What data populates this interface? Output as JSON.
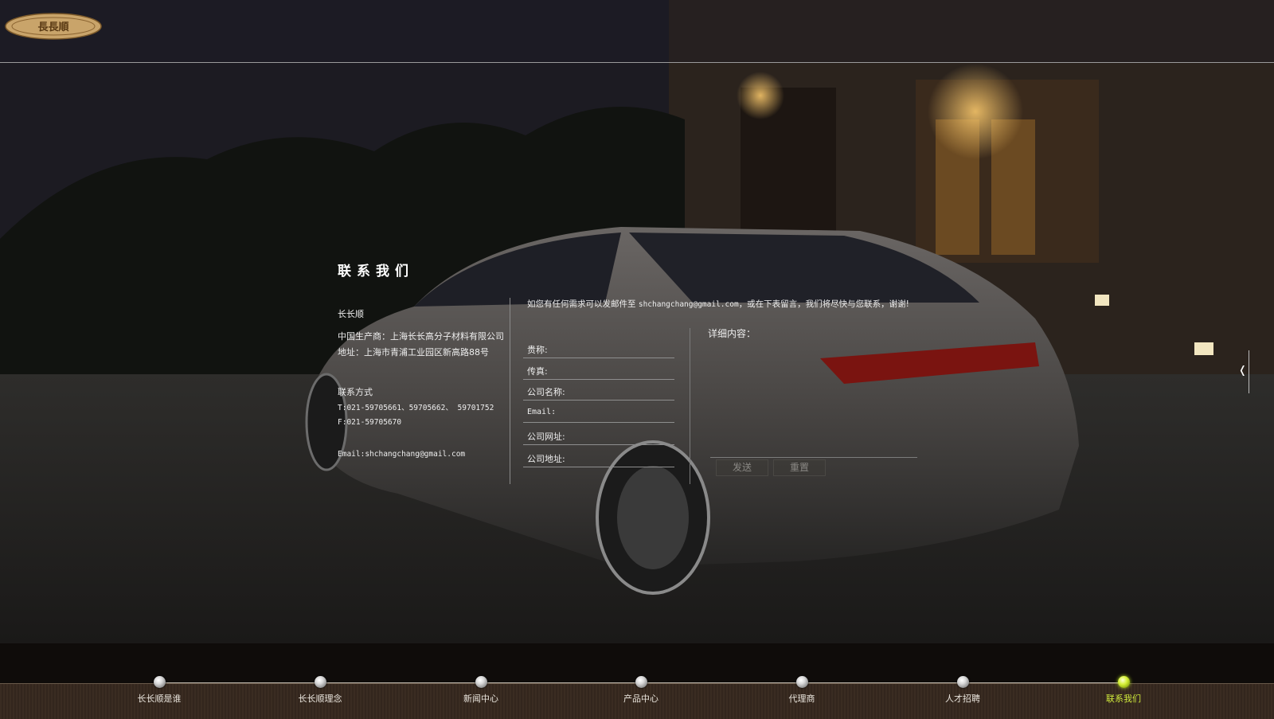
{
  "brand": {
    "logo_text": "長長順"
  },
  "contact": {
    "title": "联系我们",
    "company_short": "长长顺",
    "manufacturer": "中国生产商：上海长长高分子材料有限公司",
    "address": "地址：上海市青浦工业园区新高路88号",
    "method_label": "联系方式",
    "tel": "T:021-59705661、59705662、 59701752",
    "fax": "F:021-59705670",
    "email": "Email:shchangchang@gmail.com"
  },
  "form": {
    "intro_prefix": "如您有任何需求可以发邮件至",
    "intro_email": "shchangchang@gmail.com",
    "intro_suffix": "，或在下表留言，我们将尽快与您联系，谢谢!",
    "fields": [
      {
        "label": "贵称:"
      },
      {
        "label": "传真:"
      },
      {
        "label": "公司名称:"
      },
      {
        "label": "Email:"
      },
      {
        "label": "公司网址:"
      },
      {
        "label": "公司地址:"
      }
    ],
    "detail_label": "详细内容：",
    "send_label": "发送",
    "reset_label": "重置"
  },
  "side_tab": {
    "glyph": "❬"
  },
  "nav": {
    "items": [
      {
        "label": "长长顺是谁",
        "active": false
      },
      {
        "label": "长长顺理念",
        "active": false
      },
      {
        "label": "新闻中心",
        "active": false
      },
      {
        "label": "产品中心",
        "active": false
      },
      {
        "label": "代理商",
        "active": false
      },
      {
        "label": "人才招聘",
        "active": false
      },
      {
        "label": "联系我们",
        "active": true
      }
    ]
  },
  "colors": {
    "accent": "#cfe93b",
    "divider": "#8e8e8e",
    "footer": "#3a2c22"
  }
}
